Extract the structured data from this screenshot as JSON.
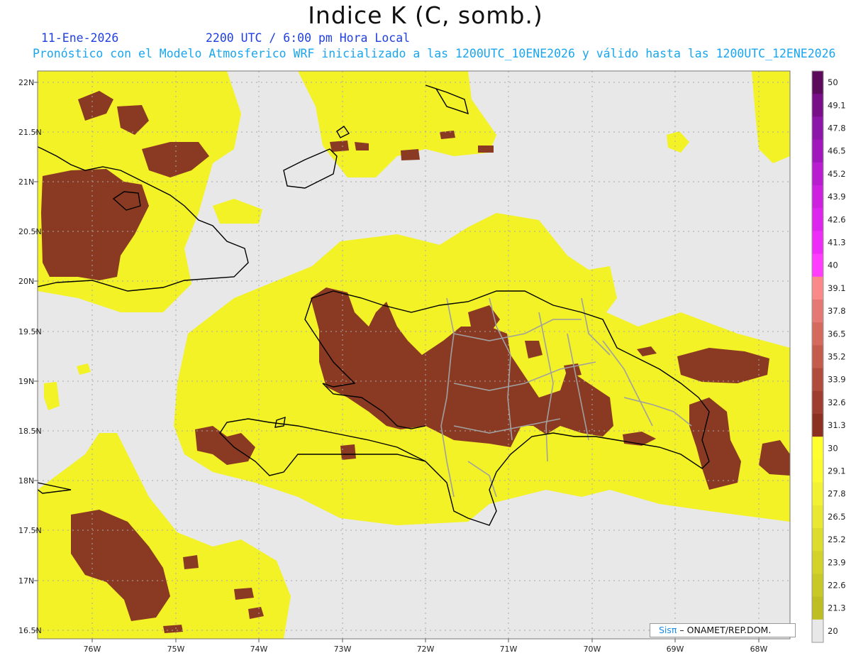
{
  "header": {
    "title": "Indice K (C, somb.)",
    "date": "11-Ene-2026",
    "time": "2200 UTC / 6:00 pm Hora Local",
    "description": "Pronóstico con el Modelo Atmosferico WRF inicializado a las 1200UTC_10ENE2026 y válido hasta las  1200UTC_12ENE2026"
  },
  "axes": {
    "lat_labels": [
      "22N",
      "21.5N",
      "21N",
      "20.5N",
      "20N",
      "19.5N",
      "19N",
      "18.5N",
      "18N",
      "17.5N",
      "17N",
      "16.5N"
    ],
    "lon_labels": [
      "76W",
      "75W",
      "74W",
      "73W",
      "72W",
      "71W",
      "70W",
      "69W",
      "68W"
    ]
  },
  "colorbar": {
    "levels": [
      "50",
      "49.1",
      "47.8",
      "46.5",
      "45.2",
      "43.9",
      "42.6",
      "41.3",
      "40",
      "39.1",
      "37.8",
      "36.5",
      "35.2",
      "33.9",
      "32.6",
      "31.3",
      "30",
      "29.1",
      "27.8",
      "26.5",
      "25.2",
      "23.9",
      "22.6",
      "21.3",
      "20"
    ],
    "colors": [
      "#5c0a5c",
      "#780e88",
      "#8c16a8",
      "#a018bc",
      "#b81ed0",
      "#cc22e0",
      "#dc26ee",
      "#ee2cf8",
      "#ff3cff",
      "#fa8a8a",
      "#e47872",
      "#d46a5e",
      "#c45c4e",
      "#b04c3e",
      "#9e3e30",
      "#8c3022",
      "#ffff2e",
      "#fafa32",
      "#f2f234",
      "#e8e832",
      "#dcdc2e",
      "#d2d22a",
      "#c8c826",
      "#bebe22",
      "#e8e8e8"
    ]
  },
  "legend_colors": {
    "background": "#e8e8e8",
    "field_low": "#f0f028",
    "field_high": "#8a3a22",
    "coastline": "#000000",
    "provinces": "#a0a0a0"
  },
  "credit": {
    "logo": "Sisπ",
    "text": " – ONAMET/REP.DOM."
  }
}
